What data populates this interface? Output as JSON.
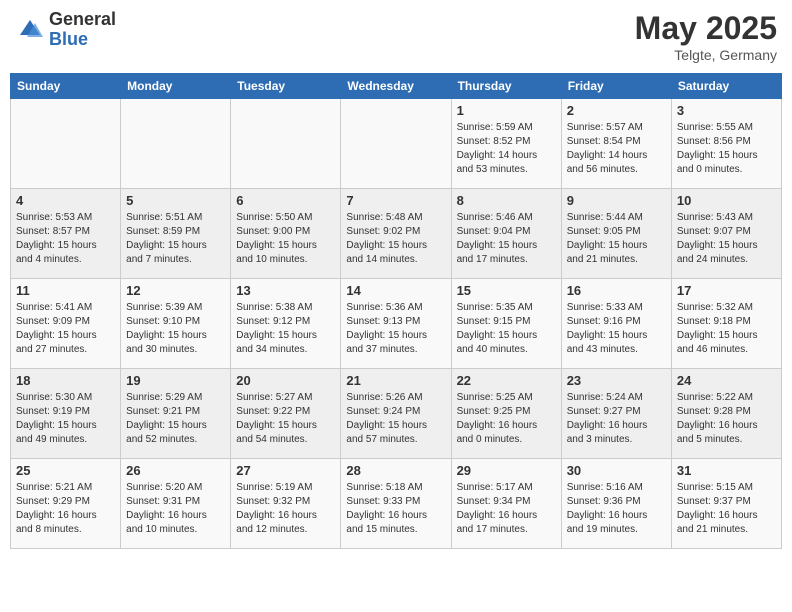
{
  "header": {
    "logo_general": "General",
    "logo_blue": "Blue",
    "title": "May 2025",
    "location": "Telgte, Germany"
  },
  "weekdays": [
    "Sunday",
    "Monday",
    "Tuesday",
    "Wednesday",
    "Thursday",
    "Friday",
    "Saturday"
  ],
  "weeks": [
    [
      {
        "day": "",
        "info": ""
      },
      {
        "day": "",
        "info": ""
      },
      {
        "day": "",
        "info": ""
      },
      {
        "day": "",
        "info": ""
      },
      {
        "day": "1",
        "info": "Sunrise: 5:59 AM\nSunset: 8:52 PM\nDaylight: 14 hours\nand 53 minutes."
      },
      {
        "day": "2",
        "info": "Sunrise: 5:57 AM\nSunset: 8:54 PM\nDaylight: 14 hours\nand 56 minutes."
      },
      {
        "day": "3",
        "info": "Sunrise: 5:55 AM\nSunset: 8:56 PM\nDaylight: 15 hours\nand 0 minutes."
      }
    ],
    [
      {
        "day": "4",
        "info": "Sunrise: 5:53 AM\nSunset: 8:57 PM\nDaylight: 15 hours\nand 4 minutes."
      },
      {
        "day": "5",
        "info": "Sunrise: 5:51 AM\nSunset: 8:59 PM\nDaylight: 15 hours\nand 7 minutes."
      },
      {
        "day": "6",
        "info": "Sunrise: 5:50 AM\nSunset: 9:00 PM\nDaylight: 15 hours\nand 10 minutes."
      },
      {
        "day": "7",
        "info": "Sunrise: 5:48 AM\nSunset: 9:02 PM\nDaylight: 15 hours\nand 14 minutes."
      },
      {
        "day": "8",
        "info": "Sunrise: 5:46 AM\nSunset: 9:04 PM\nDaylight: 15 hours\nand 17 minutes."
      },
      {
        "day": "9",
        "info": "Sunrise: 5:44 AM\nSunset: 9:05 PM\nDaylight: 15 hours\nand 21 minutes."
      },
      {
        "day": "10",
        "info": "Sunrise: 5:43 AM\nSunset: 9:07 PM\nDaylight: 15 hours\nand 24 minutes."
      }
    ],
    [
      {
        "day": "11",
        "info": "Sunrise: 5:41 AM\nSunset: 9:09 PM\nDaylight: 15 hours\nand 27 minutes."
      },
      {
        "day": "12",
        "info": "Sunrise: 5:39 AM\nSunset: 9:10 PM\nDaylight: 15 hours\nand 30 minutes."
      },
      {
        "day": "13",
        "info": "Sunrise: 5:38 AM\nSunset: 9:12 PM\nDaylight: 15 hours\nand 34 minutes."
      },
      {
        "day": "14",
        "info": "Sunrise: 5:36 AM\nSunset: 9:13 PM\nDaylight: 15 hours\nand 37 minutes."
      },
      {
        "day": "15",
        "info": "Sunrise: 5:35 AM\nSunset: 9:15 PM\nDaylight: 15 hours\nand 40 minutes."
      },
      {
        "day": "16",
        "info": "Sunrise: 5:33 AM\nSunset: 9:16 PM\nDaylight: 15 hours\nand 43 minutes."
      },
      {
        "day": "17",
        "info": "Sunrise: 5:32 AM\nSunset: 9:18 PM\nDaylight: 15 hours\nand 46 minutes."
      }
    ],
    [
      {
        "day": "18",
        "info": "Sunrise: 5:30 AM\nSunset: 9:19 PM\nDaylight: 15 hours\nand 49 minutes."
      },
      {
        "day": "19",
        "info": "Sunrise: 5:29 AM\nSunset: 9:21 PM\nDaylight: 15 hours\nand 52 minutes."
      },
      {
        "day": "20",
        "info": "Sunrise: 5:27 AM\nSunset: 9:22 PM\nDaylight: 15 hours\nand 54 minutes."
      },
      {
        "day": "21",
        "info": "Sunrise: 5:26 AM\nSunset: 9:24 PM\nDaylight: 15 hours\nand 57 minutes."
      },
      {
        "day": "22",
        "info": "Sunrise: 5:25 AM\nSunset: 9:25 PM\nDaylight: 16 hours\nand 0 minutes."
      },
      {
        "day": "23",
        "info": "Sunrise: 5:24 AM\nSunset: 9:27 PM\nDaylight: 16 hours\nand 3 minutes."
      },
      {
        "day": "24",
        "info": "Sunrise: 5:22 AM\nSunset: 9:28 PM\nDaylight: 16 hours\nand 5 minutes."
      }
    ],
    [
      {
        "day": "25",
        "info": "Sunrise: 5:21 AM\nSunset: 9:29 PM\nDaylight: 16 hours\nand 8 minutes."
      },
      {
        "day": "26",
        "info": "Sunrise: 5:20 AM\nSunset: 9:31 PM\nDaylight: 16 hours\nand 10 minutes."
      },
      {
        "day": "27",
        "info": "Sunrise: 5:19 AM\nSunset: 9:32 PM\nDaylight: 16 hours\nand 12 minutes."
      },
      {
        "day": "28",
        "info": "Sunrise: 5:18 AM\nSunset: 9:33 PM\nDaylight: 16 hours\nand 15 minutes."
      },
      {
        "day": "29",
        "info": "Sunrise: 5:17 AM\nSunset: 9:34 PM\nDaylight: 16 hours\nand 17 minutes."
      },
      {
        "day": "30",
        "info": "Sunrise: 5:16 AM\nSunset: 9:36 PM\nDaylight: 16 hours\nand 19 minutes."
      },
      {
        "day": "31",
        "info": "Sunrise: 5:15 AM\nSunset: 9:37 PM\nDaylight: 16 hours\nand 21 minutes."
      }
    ]
  ]
}
